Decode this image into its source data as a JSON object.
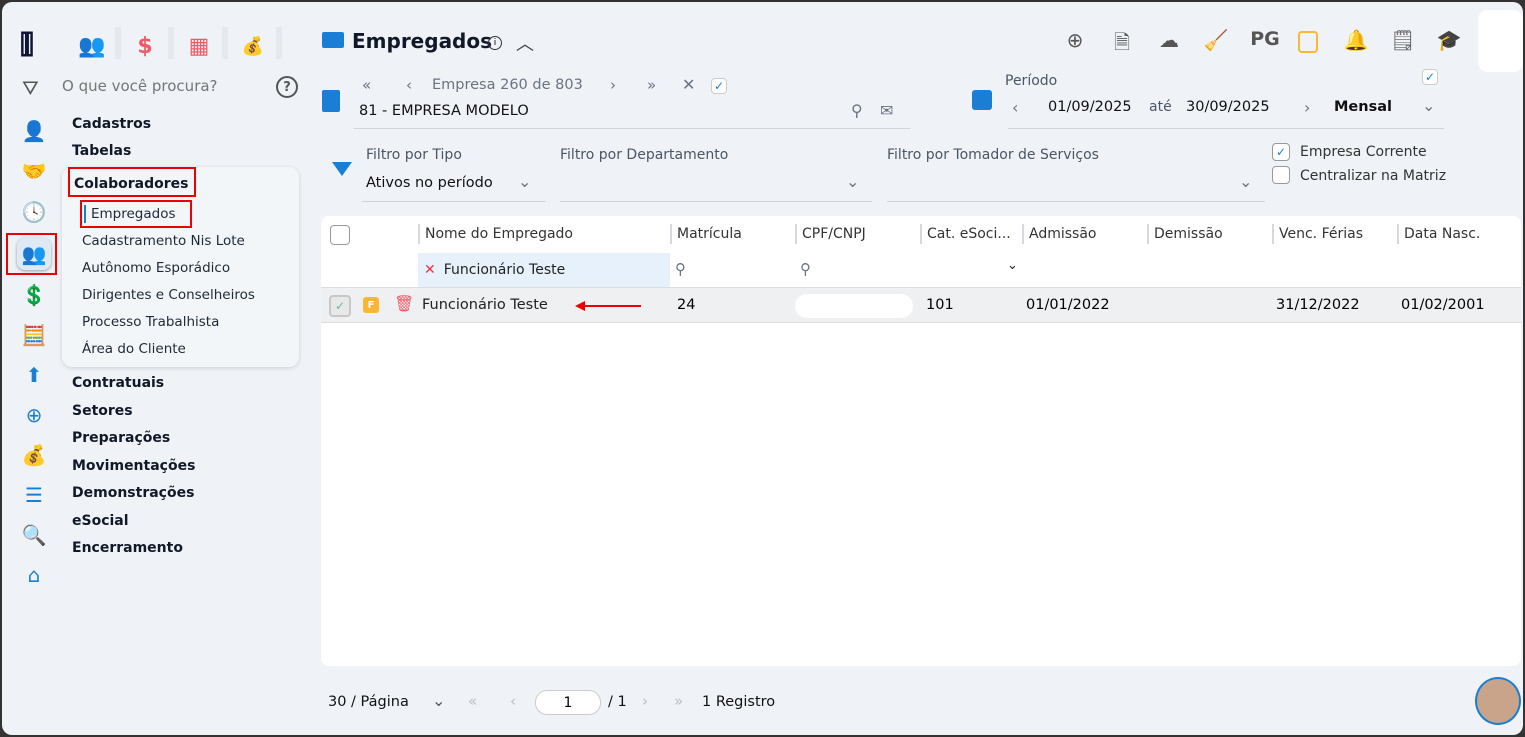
{
  "top_apps": [
    {
      "name": "people"
    },
    {
      "name": "dollar"
    },
    {
      "name": "calculator"
    },
    {
      "name": "money-bag"
    }
  ],
  "search": {
    "placeholder": "O que você procura?"
  },
  "rail": [
    "user-gear",
    "handshake",
    "clock",
    "people",
    "dollar",
    "calculator",
    "arrow-up",
    "network",
    "money-bag",
    "layers",
    "search",
    "home"
  ],
  "nav": {
    "cadastros": "Cadastros",
    "tabelas": "Tabelas",
    "colaboradores": "Colaboradores",
    "sub": [
      "Empregados",
      "Cadastramento Nis Lote",
      "Autônomo Esporádico",
      "Dirigentes e Conselheiros",
      "Processo Trabalhista",
      "Área do Cliente"
    ],
    "rest": [
      "Contratuais",
      "Setores",
      "Preparações",
      "Movimentações",
      "Demonstrações",
      "eSocial",
      "Encerramento"
    ]
  },
  "header": {
    "title": "Empregados",
    "toolbar_pg": "PG"
  },
  "empresa": {
    "nav_text": "Empresa 260 de 803",
    "value": "81 - EMPRESA MODELO"
  },
  "periodo": {
    "label": "Período",
    "start": "01/09/2025",
    "sep": "até",
    "end": "30/09/2025",
    "type": "Mensal"
  },
  "filters": {
    "tipo_label": "Filtro por Tipo",
    "tipo_value": "Ativos no período",
    "depto_label": "Filtro por Departamento",
    "tomador_label": "Filtro por Tomador de Serviços",
    "empresa_corrente": "Empresa Corrente",
    "centralizar": "Centralizar na Matriz"
  },
  "table": {
    "columns": [
      "Nome do Empregado",
      "Matrícula",
      "CPF/CNPJ",
      "Cat. eSoci...",
      "Admissão",
      "Demissão",
      "Venc. Férias",
      "Data Nasc."
    ],
    "name_filter": "Funcionário Teste",
    "rows": [
      {
        "badge": "F",
        "nome": "Funcionário Teste",
        "matricula": "24",
        "cpf": "",
        "cat": "101",
        "admissao": "01/01/2022",
        "demissao": "",
        "venc_ferias": "31/12/2022",
        "data_nasc": "01/02/2001"
      }
    ]
  },
  "pagination": {
    "per_page": "30 / Página",
    "page": "1",
    "total_pages": "/ 1",
    "records": "1 Registro"
  },
  "colors": {
    "accent": "#1a7fd4",
    "highlight": "#ff0000",
    "badge": "#fbb731"
  }
}
